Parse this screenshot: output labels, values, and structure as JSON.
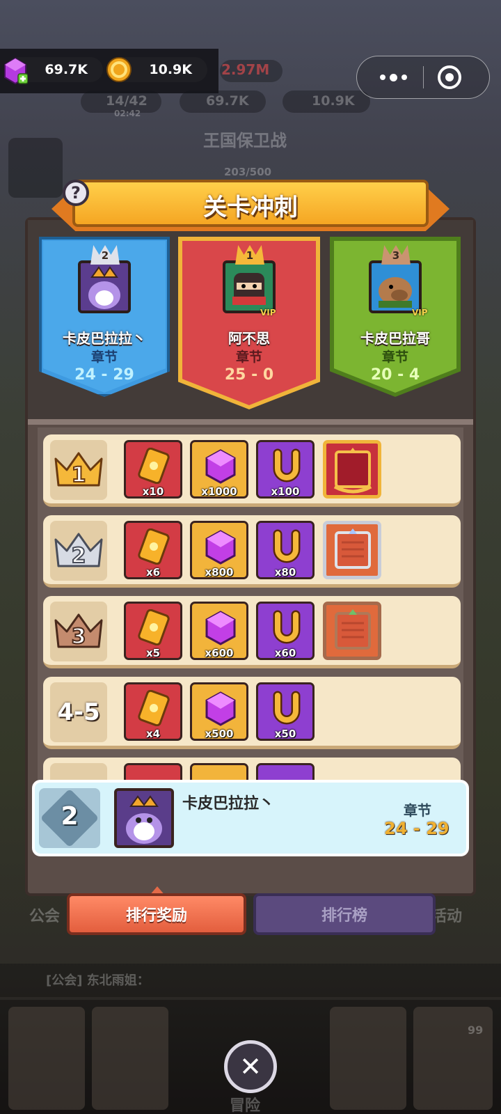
{
  "currencies": {
    "gems": "69.7K",
    "coins": "10.9K"
  },
  "background": {
    "power": "2.97M",
    "energy": "14/42",
    "energy_timer": "02:42",
    "gems": "69.7K",
    "coins": "10.9K",
    "event_title": "王国保卫战",
    "event_progress": "203/500",
    "nav_left": "公会",
    "nav_right": "活动",
    "chat_line": "[公会] 东北雨姐：",
    "bottom_center": "冒险",
    "badge_count": "99"
  },
  "modal": {
    "title": "关卡冲刺",
    "help_glyph": "?",
    "podium": [
      {
        "rank": "2",
        "name": "卡皮巴拉拉丶",
        "chapter_label": "章节",
        "score": "24 - 29",
        "vip": false,
        "color": "#3a90d6"
      },
      {
        "rank": "1",
        "name": "阿不思",
        "chapter_label": "章节",
        "score": "25 - 0",
        "vip": true,
        "vip_label": "VIP",
        "color": "#d9474a"
      },
      {
        "rank": "3",
        "name": "卡皮巴拉哥",
        "chapter_label": "章节",
        "score": "20 - 4",
        "vip": true,
        "vip_label": "VIP",
        "color": "#76b02f"
      }
    ],
    "rewards": [
      {
        "rank": "1",
        "tickets": "x10",
        "gems": "x1000",
        "horseshoes": "x100",
        "frame": "gold"
      },
      {
        "rank": "2",
        "tickets": "x6",
        "gems": "x800",
        "horseshoes": "x80",
        "frame": "silver"
      },
      {
        "rank": "3",
        "tickets": "x5",
        "gems": "x600",
        "horseshoes": "x60",
        "frame": "bronze"
      },
      {
        "rank": "4-5",
        "tickets": "x4",
        "gems": "x500",
        "horseshoes": "x50",
        "frame": ""
      }
    ],
    "my_rank": {
      "rank": "2",
      "name": "卡皮巴拉拉丶",
      "chapter_label": "章节",
      "score": "24 - 29"
    },
    "tabs": [
      {
        "label": "排行奖励",
        "active": true
      },
      {
        "label": "排行榜",
        "active": false
      }
    ],
    "close_glyph": "✕"
  },
  "icons": [
    "gem-icon",
    "coin-icon",
    "more-icon",
    "target-icon",
    "help-icon",
    "crown-icon",
    "ticket-icon",
    "horseshoe-icon",
    "frame-icon",
    "close-icon"
  ]
}
